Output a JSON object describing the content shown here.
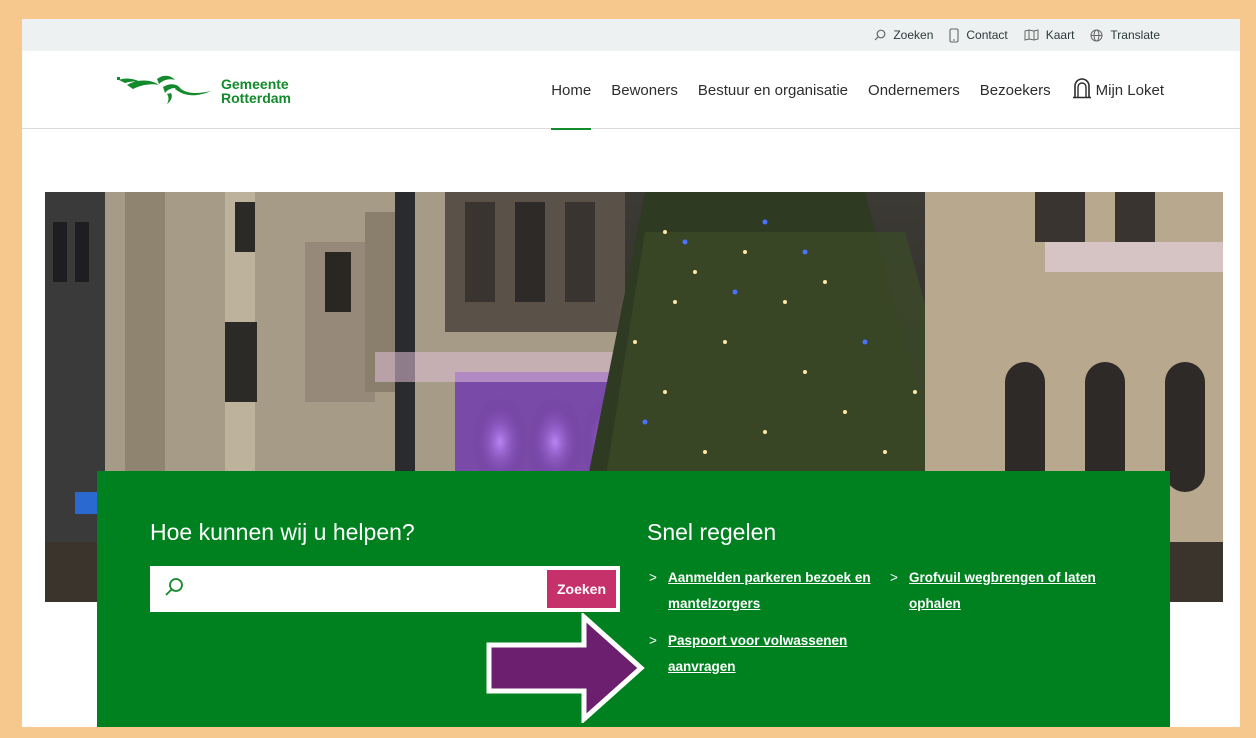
{
  "utility": {
    "items": [
      {
        "label": "Zoeken",
        "icon": "search-icon"
      },
      {
        "label": "Contact",
        "icon": "phone-icon"
      },
      {
        "label": "Kaart",
        "icon": "map-icon"
      },
      {
        "label": "Translate",
        "icon": "globe-icon"
      }
    ]
  },
  "logo": {
    "line1": "Gemeente",
    "line2": "Rotterdam"
  },
  "nav": {
    "home": "Home",
    "bewoners": "Bewoners",
    "bestuur": "Bestuur en organisatie",
    "ondernemers": "Ondernemers",
    "bezoekers": "Bezoekers",
    "loket": "Mijn Loket"
  },
  "help": {
    "title": "Hoe kunnen wij u helpen?",
    "search_value": "",
    "search_button": "Zoeken"
  },
  "snel": {
    "title": "Snel regelen",
    "links": [
      {
        "label": "Aanmelden parkeren bezoek en mantelzorgers"
      },
      {
        "label": "Grofvuil wegbrengen of laten ophalen"
      },
      {
        "label": "Paspoort voor volwassenen aanvragen"
      }
    ]
  },
  "colors": {
    "brand_green": "#00811f",
    "logo_green": "#138a2c",
    "search_button": "#c7316b",
    "arrow": "#6b1f6e",
    "frame": "#f6c88d"
  }
}
